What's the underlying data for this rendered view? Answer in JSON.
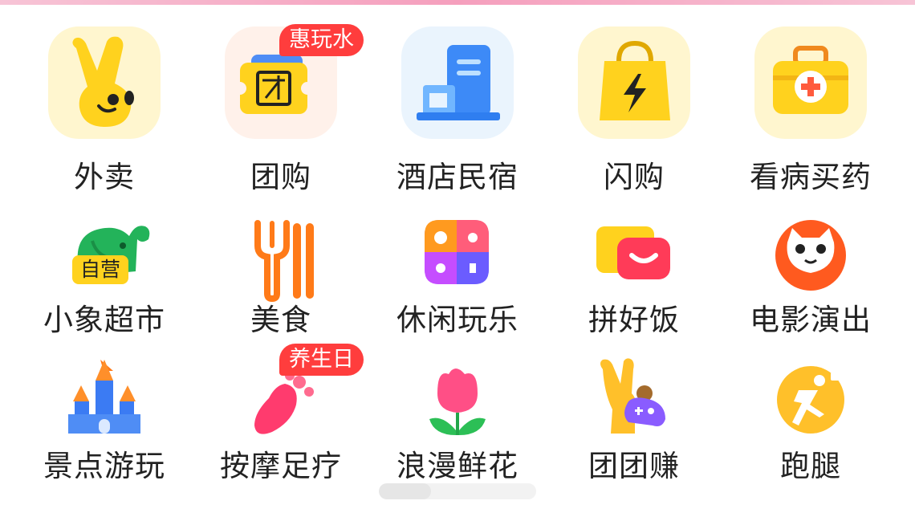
{
  "menu": {
    "rows": [
      [
        {
          "label": "外卖",
          "icon": "kangaroo-ear-icon"
        },
        {
          "label": "团购",
          "icon": "group-ticket-icon",
          "badge": "惠玩水"
        },
        {
          "label": "酒店民宿",
          "icon": "hotel-building-icon"
        },
        {
          "label": "闪购",
          "icon": "lightning-bag-icon"
        },
        {
          "label": "看病买药",
          "icon": "medical-kit-icon"
        }
      ],
      [
        {
          "label": "小象超市",
          "icon": "elephant-icon",
          "tag": "自营"
        },
        {
          "label": "美食",
          "icon": "fork-chopsticks-icon"
        },
        {
          "label": "休闲玩乐",
          "icon": "leisure-grid-icon"
        },
        {
          "label": "拼好饭",
          "icon": "smile-bowl-icon"
        },
        {
          "label": "电影演出",
          "icon": "cat-face-icon"
        }
      ],
      [
        {
          "label": "景点游玩",
          "icon": "castle-icon"
        },
        {
          "label": "按摩足疗",
          "icon": "footprint-icon",
          "badge": "养生日"
        },
        {
          "label": "浪漫鲜花",
          "icon": "tulip-icon"
        },
        {
          "label": "团团赚",
          "icon": "gamepad-mascot-icon"
        },
        {
          "label": "跑腿",
          "icon": "runner-icon"
        }
      ]
    ]
  },
  "pager": {
    "current_page": 1,
    "total_pages": 3
  },
  "colors": {
    "badge": "#ff3d3d",
    "text": "#222222",
    "brand_yellow": "#ffd21e",
    "accent_red": "#ff3b58"
  }
}
